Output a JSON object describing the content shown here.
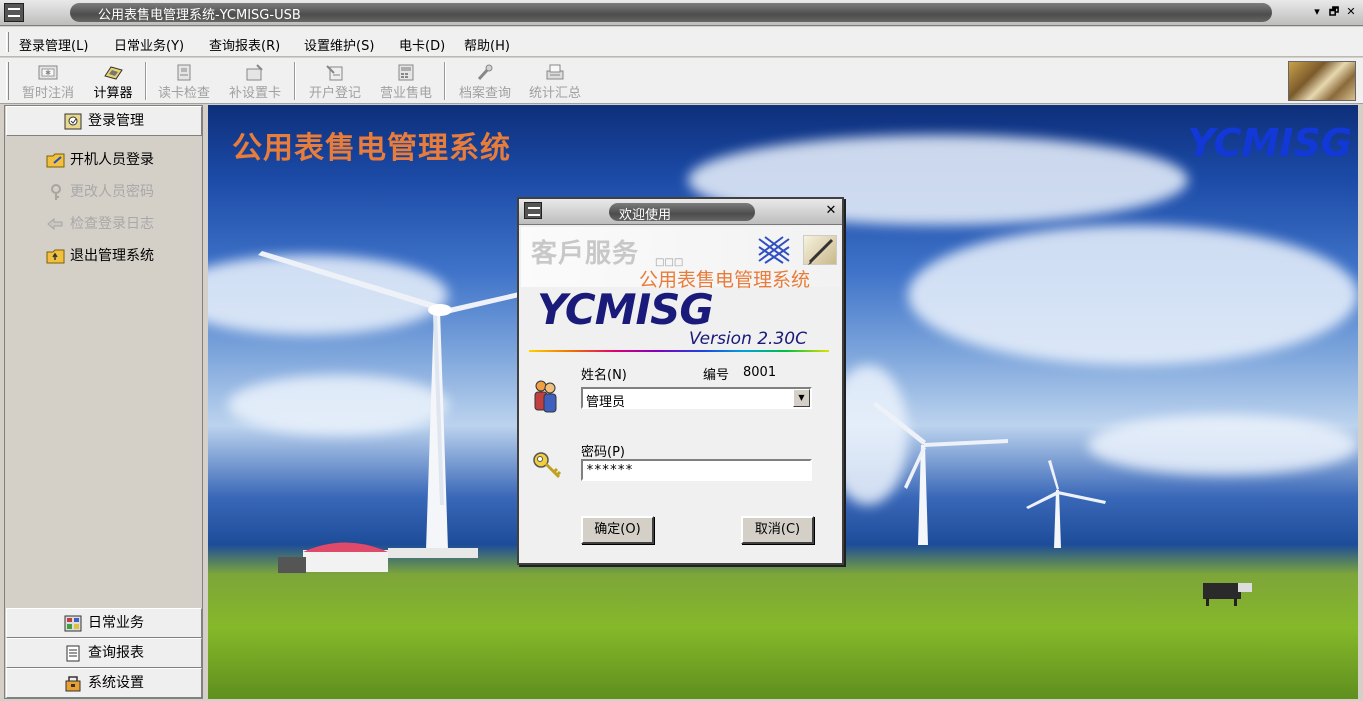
{
  "window": {
    "title": "公用表售电管理系统-YCMISG-USB",
    "minimize_glyph": "▾",
    "restore_glyph": "🗗",
    "close_glyph": "✕"
  },
  "menu": [
    {
      "label": "登录管理(L)"
    },
    {
      "label": "日常业务(Y)"
    },
    {
      "label": "查询报表(R)"
    },
    {
      "label": "设置维护(S)"
    },
    {
      "label": "电卡(D)"
    },
    {
      "label": "帮助(H)"
    }
  ],
  "toolbar": [
    {
      "label": "暂时注消",
      "icon": "suspend-icon",
      "enabled": false
    },
    {
      "label": "计算器",
      "icon": "calculator-icon",
      "enabled": true
    },
    {
      "label": "读卡检查",
      "icon": "read-card-icon",
      "enabled": false
    },
    {
      "label": "补设置卡",
      "icon": "set-card-icon",
      "enabled": false
    },
    {
      "label": "开户登记",
      "icon": "open-account-icon",
      "enabled": false
    },
    {
      "label": "营业售电",
      "icon": "sell-power-icon",
      "enabled": false
    },
    {
      "label": "档案查询",
      "icon": "archive-icon",
      "enabled": false
    },
    {
      "label": "统计汇总",
      "icon": "statistics-icon",
      "enabled": false
    }
  ],
  "sidebar": {
    "active_section": "登录管理",
    "items": [
      {
        "label": "开机人员登录",
        "icon": "login-folder-icon",
        "enabled": true
      },
      {
        "label": "更改人员密码",
        "icon": "change-password-icon",
        "enabled": false
      },
      {
        "label": "检查登录日志",
        "icon": "login-log-icon",
        "enabled": false
      },
      {
        "label": "退出管理系统",
        "icon": "exit-folder-icon",
        "enabled": true
      }
    ],
    "bottom_sections": [
      {
        "label": "日常业务",
        "icon": "daily-business-icon"
      },
      {
        "label": "查询报表",
        "icon": "query-report-icon"
      },
      {
        "label": "系统设置",
        "icon": "system-settings-icon"
      }
    ]
  },
  "main": {
    "title": "公用表售电管理系统",
    "logo": "YCMISG"
  },
  "dialog": {
    "title": "欢迎使用",
    "close_glyph": "✕",
    "banner_service": "客戶服务",
    "banner_boxes": "□□□",
    "banner_subtitle": "公用表售电管理系统",
    "logo": "YCMISG",
    "version": "Version  2.30C",
    "name_label": "姓名(N)",
    "id_label": "编号",
    "id_value": "8001",
    "name_value": "管理员",
    "password_label": "密码(P)",
    "password_value": "******",
    "ok_label": "确定(O)",
    "cancel_label": "取消(C)"
  },
  "colors": {
    "accent_orange": "#e87c3a",
    "logo_blue": "#1238d8",
    "dialog_logo": "#1a1a7a"
  }
}
